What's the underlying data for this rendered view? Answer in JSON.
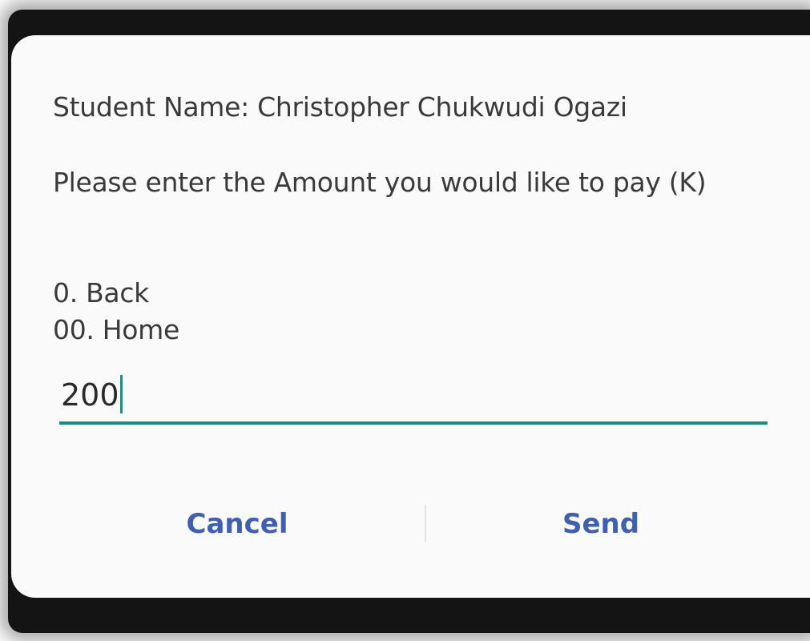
{
  "dialog": {
    "student_name_line": "Student Name: Christopher Chukwudi  Ogazi",
    "prompt_line": "Please enter the Amount you would like to pay (K)",
    "option_back": "0. Back",
    "option_home": "00. Home",
    "amount_input": {
      "value": "200",
      "placeholder": ""
    },
    "buttons": {
      "cancel_label": "Cancel",
      "send_label": "Send"
    }
  },
  "colors": {
    "accent": "#1f8a7e",
    "button_text": "#3f5fb0",
    "dialog_background": "#fafafa",
    "frame_background": "#141414"
  }
}
